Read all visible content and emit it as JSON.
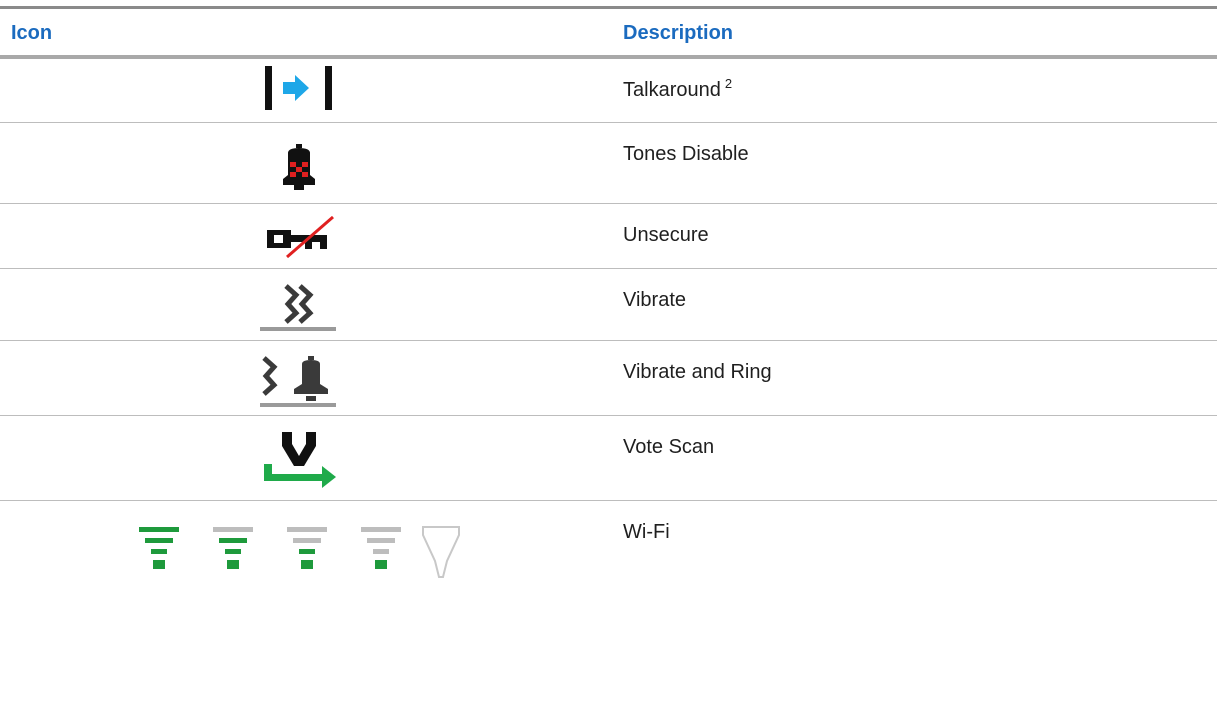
{
  "table": {
    "headers": {
      "icon": "Icon",
      "description": "Description"
    },
    "rows": [
      {
        "icon": "talkaround-icon",
        "description": "Talkaround",
        "footnote": "2"
      },
      {
        "icon": "tones-disable-icon",
        "description": "Tones Disable"
      },
      {
        "icon": "unsecure-key-icon",
        "description": "Unsecure"
      },
      {
        "icon": "vibrate-icon",
        "description": "Vibrate"
      },
      {
        "icon": "vibrate-and-ring-icon",
        "description": "Vibrate and Ring"
      },
      {
        "icon": "vote-scan-icon",
        "description": "Vote Scan"
      },
      {
        "icon": "wifi-signal-icons",
        "description": "Wi-Fi"
      }
    ]
  },
  "colors": {
    "header_text": "#1b6bbf",
    "talkaround_arrow": "#1ea7e8",
    "tones_disable_x": "#e02020",
    "unsecure_slash": "#e02020",
    "vote_scan_arrow": "#1faa4a",
    "wifi_active": "#1e9a3c",
    "wifi_inactive": "#bdbdbd"
  }
}
